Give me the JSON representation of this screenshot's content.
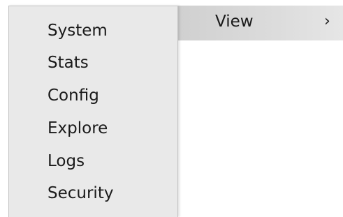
{
  "parent_menu": {
    "label": "View",
    "chevron": "›",
    "chevron_icon": "chevron-right-icon"
  },
  "submenu": {
    "items": [
      {
        "label": "System"
      },
      {
        "label": "Stats"
      },
      {
        "label": "Config"
      },
      {
        "label": "Explore"
      },
      {
        "label": "Logs"
      },
      {
        "label": "Security"
      }
    ]
  },
  "colors": {
    "panel_background": "#e9e9e9",
    "highlight": "#d2d2d2",
    "text": "#1a1a1a"
  }
}
